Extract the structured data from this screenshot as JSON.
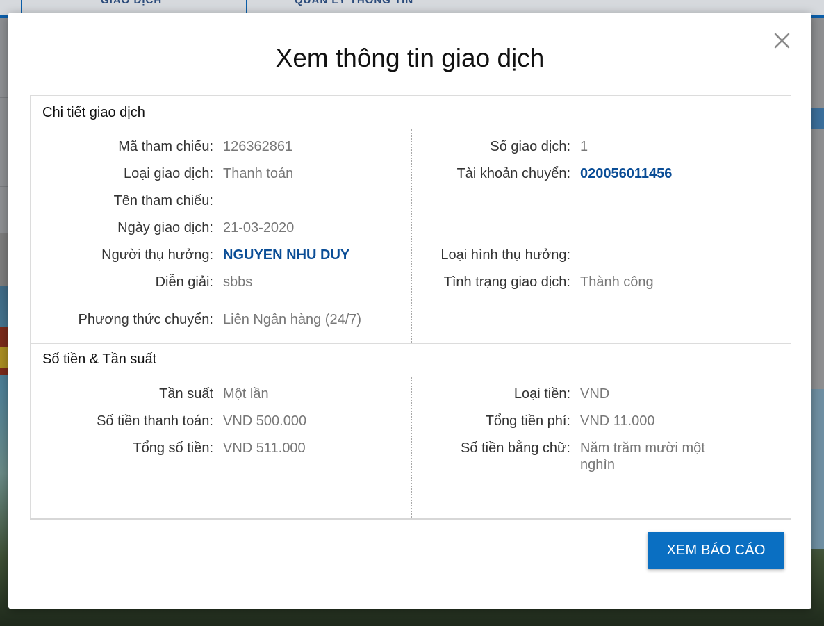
{
  "background": {
    "nav_tabs": [
      "GIAO DỊCH",
      "QUẢN LÝ THÔNG TIN"
    ]
  },
  "modal": {
    "title": "Xem thông tin giao dịch",
    "close_icon": "close-icon",
    "sections": {
      "details": {
        "title": "Chi tiết giao dịch",
        "left": [
          {
            "label": "Mã tham chiếu:",
            "value": "126362861"
          },
          {
            "label": "Loại giao dịch:",
            "value": "Thanh toán"
          },
          {
            "label": "Tên tham chiếu:",
            "value": ""
          },
          {
            "label": "Ngày giao dịch:",
            "value": "21-03-2020"
          },
          {
            "label": "Người thụ hưởng:",
            "value": "NGUYEN NHU DUY"
          },
          {
            "label": "Diễn giải:",
            "value": "sbbs"
          },
          {
            "label": "Phương thức chuyển:",
            "value": "Liên Ngân hàng (24/7)"
          }
        ],
        "right": [
          {
            "label": "Số giao dịch:",
            "value": "1"
          },
          {
            "label": "Tài khoản chuyển:",
            "value": "020056011456"
          },
          {
            "label": "Loại hình thụ hưởng:",
            "value": ""
          },
          {
            "label": "Tình trạng giao dịch:",
            "value": "Thành công"
          }
        ]
      },
      "amount": {
        "title": "Số tiền & Tần suất",
        "left": [
          {
            "label": "Tần suất",
            "value": "Một lần"
          },
          {
            "label": "Số tiền thanh toán:",
            "value": "VND 500.000"
          },
          {
            "label": "Tổng số tiền:",
            "value": "VND 511.000"
          }
        ],
        "right": [
          {
            "label": "Loại tiền:",
            "value": "VND"
          },
          {
            "label": "Tổng tiền phí:",
            "value": "VND 11.000"
          },
          {
            "label": "Số tiền bằng chữ:",
            "value": "Năm trăm mười một nghìn"
          }
        ]
      }
    },
    "report_button": "XEM BÁO CÁO"
  },
  "colors": {
    "link": "#0a4d96",
    "primary_button": "#0a6fc2",
    "value_text": "#777777"
  }
}
